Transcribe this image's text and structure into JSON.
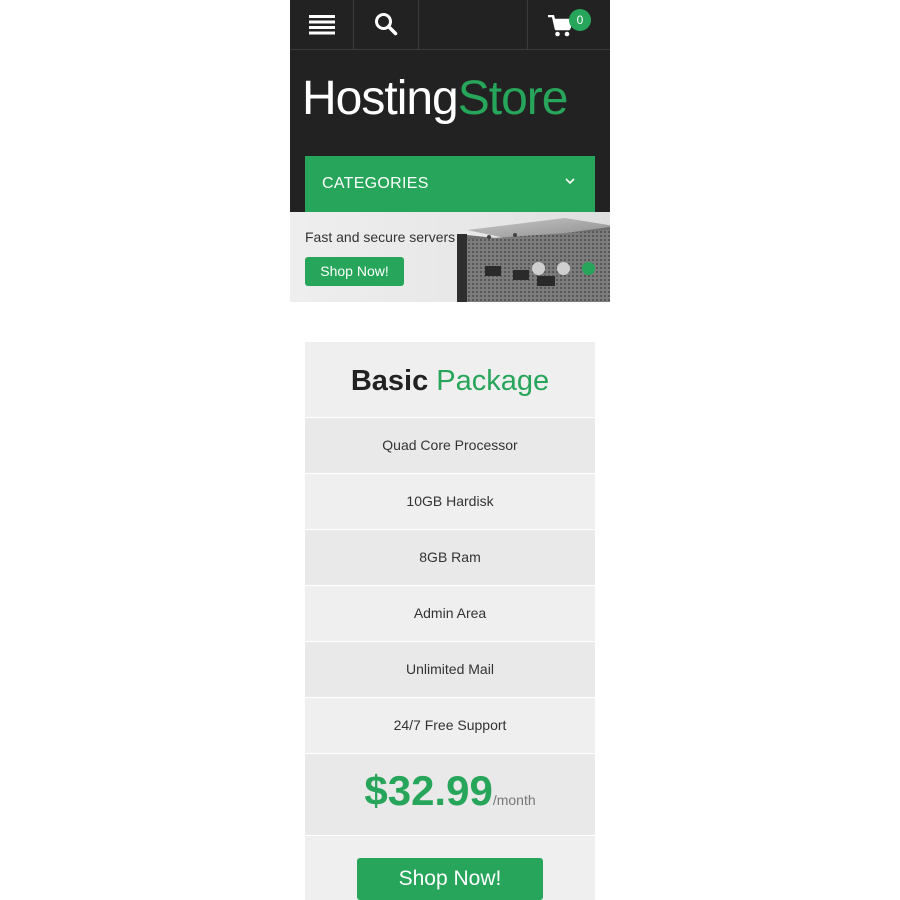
{
  "topbar": {
    "menu_icon": "hamburger-icon",
    "search_icon": "search-icon",
    "cart_icon": "cart-icon",
    "cart_count": "0"
  },
  "header": {
    "logo_part1": "Hosting",
    "logo_part2": "Store",
    "categories_label": "CATEGORIES",
    "categories_icon": "chevron-down-icon"
  },
  "banner": {
    "text": "Fast and secure servers",
    "button_label": "Shop Now!",
    "slide_count": 3,
    "active_slide": 3
  },
  "pricing": {
    "title_part1": "Basic",
    "title_part2": "Package",
    "features": [
      "Quad Core Processor",
      "10GB Hardisk",
      "8GB Ram",
      "Admin Area",
      "Unlimited Mail",
      "24/7 Free Support"
    ],
    "price": "$32.99",
    "period": "/month",
    "button_label": "Shop Now!"
  },
  "colors": {
    "accent": "#27a55a",
    "dark": "#222222",
    "panel": "#efefef"
  }
}
